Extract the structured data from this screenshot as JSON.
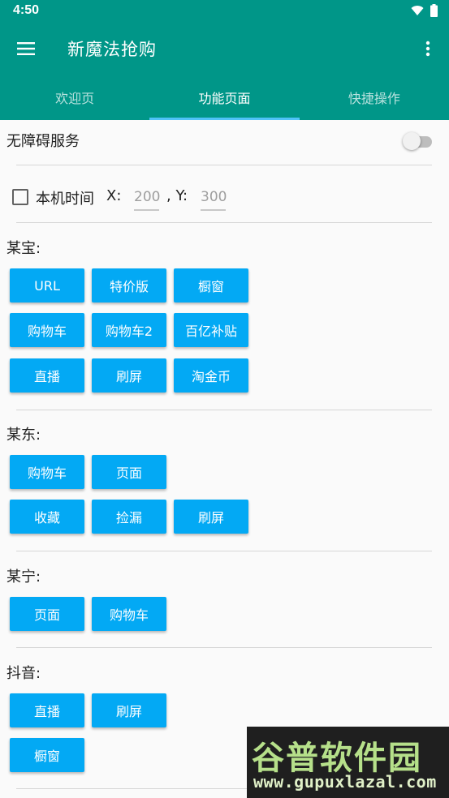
{
  "status_bar": {
    "time": "4:50"
  },
  "app_bar": {
    "title": "新魔法抢购"
  },
  "tabs": [
    {
      "label": "欢迎页",
      "active": false
    },
    {
      "label": "功能页面",
      "active": true
    },
    {
      "label": "快捷操作",
      "active": false
    }
  ],
  "accessibility": {
    "label": "无障碍服务",
    "enabled": false
  },
  "local_time": {
    "checkbox_label": "本机时间",
    "checked": false,
    "x_label": "X:",
    "x_placeholder": "200",
    "y_label": ", Y:",
    "y_placeholder": "300"
  },
  "sections": [
    {
      "title": "某宝:",
      "buttons": [
        "URL",
        "特价版",
        "橱窗",
        "购物车",
        "购物车2",
        "百亿补贴",
        "直播",
        "刷屏",
        "淘金币"
      ]
    },
    {
      "title": "某东:",
      "buttons": [
        "购物车",
        "页面",
        "收藏",
        "捡漏",
        "刷屏"
      ]
    },
    {
      "title": "某宁:",
      "buttons": [
        "页面",
        "购物车"
      ]
    },
    {
      "title": "抖音:",
      "buttons": [
        "直播",
        "刷屏",
        "橱窗"
      ]
    }
  ],
  "watermark": {
    "name": "谷普软件园",
    "url": "www.gupuxlazal.com"
  },
  "colors": {
    "primary": "#009688",
    "button": "#03a9f4",
    "tab_indicator": "#4fc3f7"
  }
}
